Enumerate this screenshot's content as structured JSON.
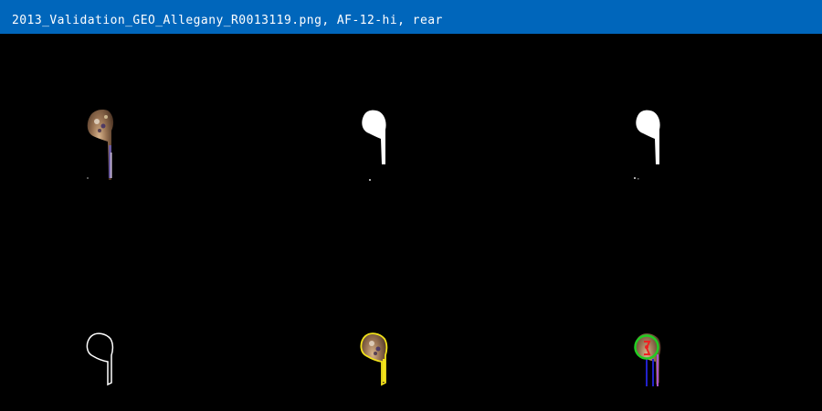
{
  "window": {
    "title": "2013_Validation_GEO_Allegany_R0013119.png, AF-12-hi, rear"
  },
  "colors": {
    "titlebar": "#0066bb",
    "background": "#000000",
    "mask": "#ffffff",
    "outline": "#ffffff",
    "yellow_contour": "#f2e21a",
    "green_circle": "#22cc22",
    "red_marker": "#ee2222",
    "blue_line": "#2222cc",
    "purple_line": "#aa55cc"
  },
  "panels": [
    {
      "id": "original",
      "icon": "tuber-photo-icon"
    },
    {
      "id": "mask",
      "icon": "binary-mask-icon"
    },
    {
      "id": "mask-cleaned",
      "icon": "binary-mask-icon"
    },
    {
      "id": "outline",
      "icon": "outline-icon"
    },
    {
      "id": "contour-overlay",
      "icon": "contour-overlay-icon"
    },
    {
      "id": "measurement",
      "icon": "measurement-overlay-icon"
    }
  ]
}
